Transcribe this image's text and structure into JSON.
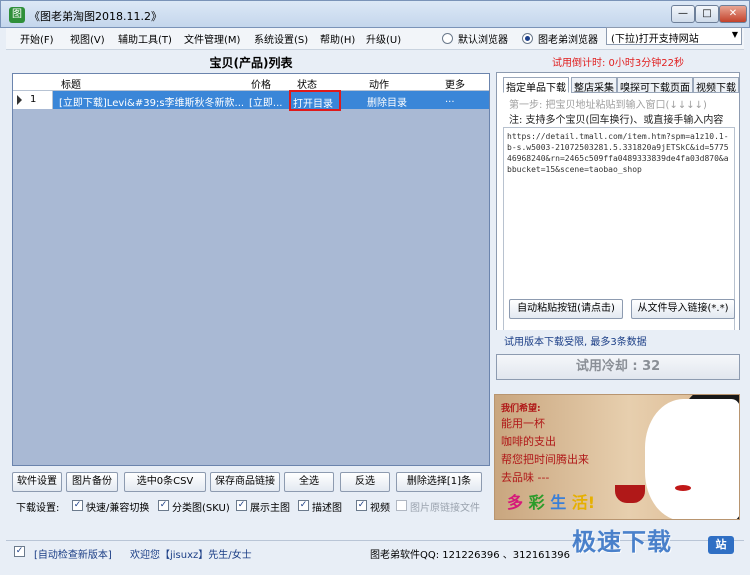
{
  "window": {
    "title": "《图老弟淘图2018.11.2》",
    "icon": "app-logo-icon",
    "controls": [
      "—",
      "□",
      "✕"
    ]
  },
  "menu": {
    "items": [
      "开始(F)",
      "视图(V)",
      "辅助工具(T)",
      "文件管理(M)",
      "系统设置(S)",
      "帮助(H)",
      "升级(U)"
    ],
    "browser_options": [
      {
        "label": "默认浏览器",
        "selected": false
      },
      {
        "label": "图老弟浏览器",
        "selected": true
      }
    ],
    "site_dropdown": "(下拉)打开支持网站"
  },
  "product_list": {
    "title": "宝贝(产品)列表",
    "columns": [
      "标题",
      "价格",
      "状态",
      "动作",
      "更多"
    ],
    "rows": [
      {
        "index": "1",
        "title": "[立即下载]Levi&#39;s李维斯秋冬新款...",
        "price": "[立即...",
        "status": "打开目录",
        "action": "删除目录",
        "more": "..."
      }
    ]
  },
  "buttons": {
    "software_settings": "软件设置",
    "image_backup": "图片备份",
    "select_csv": "选中0条CSV",
    "save_links": "保存商品链接",
    "select_all": "全选",
    "invert": "反选",
    "delete_selected": "删除选择[1]条"
  },
  "download_settings": {
    "label": "下载设置:",
    "options": [
      {
        "label": "快速/兼容切换",
        "checked": true,
        "enabled": true
      },
      {
        "label": "分类图(SKU)",
        "checked": true,
        "enabled": true
      },
      {
        "label": "展示主图",
        "checked": true,
        "enabled": true
      },
      {
        "label": "描述图",
        "checked": true,
        "enabled": true
      },
      {
        "label": "视频",
        "checked": true,
        "enabled": true
      },
      {
        "label": "图片原链接文件",
        "checked": false,
        "enabled": false
      }
    ]
  },
  "right_panel": {
    "countdown": "试用倒计时: 0小时3分钟22秒",
    "tabs": [
      "指定单品下载",
      "整店采集",
      "嗅探可下载页面",
      "视频下载"
    ],
    "step_hint": "第一步: 把宝贝地址粘贴到输入窗口(↓↓↓↓)",
    "note": "注: 支持多个宝贝(回车换行)、或直接手输入内容",
    "url_text": "https://detail.tmall.com/item.htm?spm=a1z10.1-b-s.w5003-21072503281.5.331820a9jETSkC&id=577546968240&rn=2465c509ffa0489333839de4fa03d870&abbucket=15&scene=taobao_shop",
    "auto_paste_button": "自动粘贴按钮(请点击)",
    "import_button": "从文件导入链接(*.*)",
    "trial_limit": "试用版本下载受限, 最多3条数据",
    "cooldown": "试用冷却 : 32"
  },
  "ad": {
    "wish": "我们希望:",
    "lines": [
      "能用一杯",
      "咖啡的支出",
      "帮您把时间腾出来",
      "去品味 ---"
    ],
    "colorful": [
      "多",
      "彩",
      "生",
      "活!"
    ]
  },
  "statusbar": {
    "auto_check": "[自动检查新版本]",
    "welcome": "欢迎您【jisuxz】先生/女士",
    "qq": "图老弟软件QQ: 121226396 、312161396"
  },
  "watermark": {
    "text": "极速下载",
    "badge": "站"
  }
}
